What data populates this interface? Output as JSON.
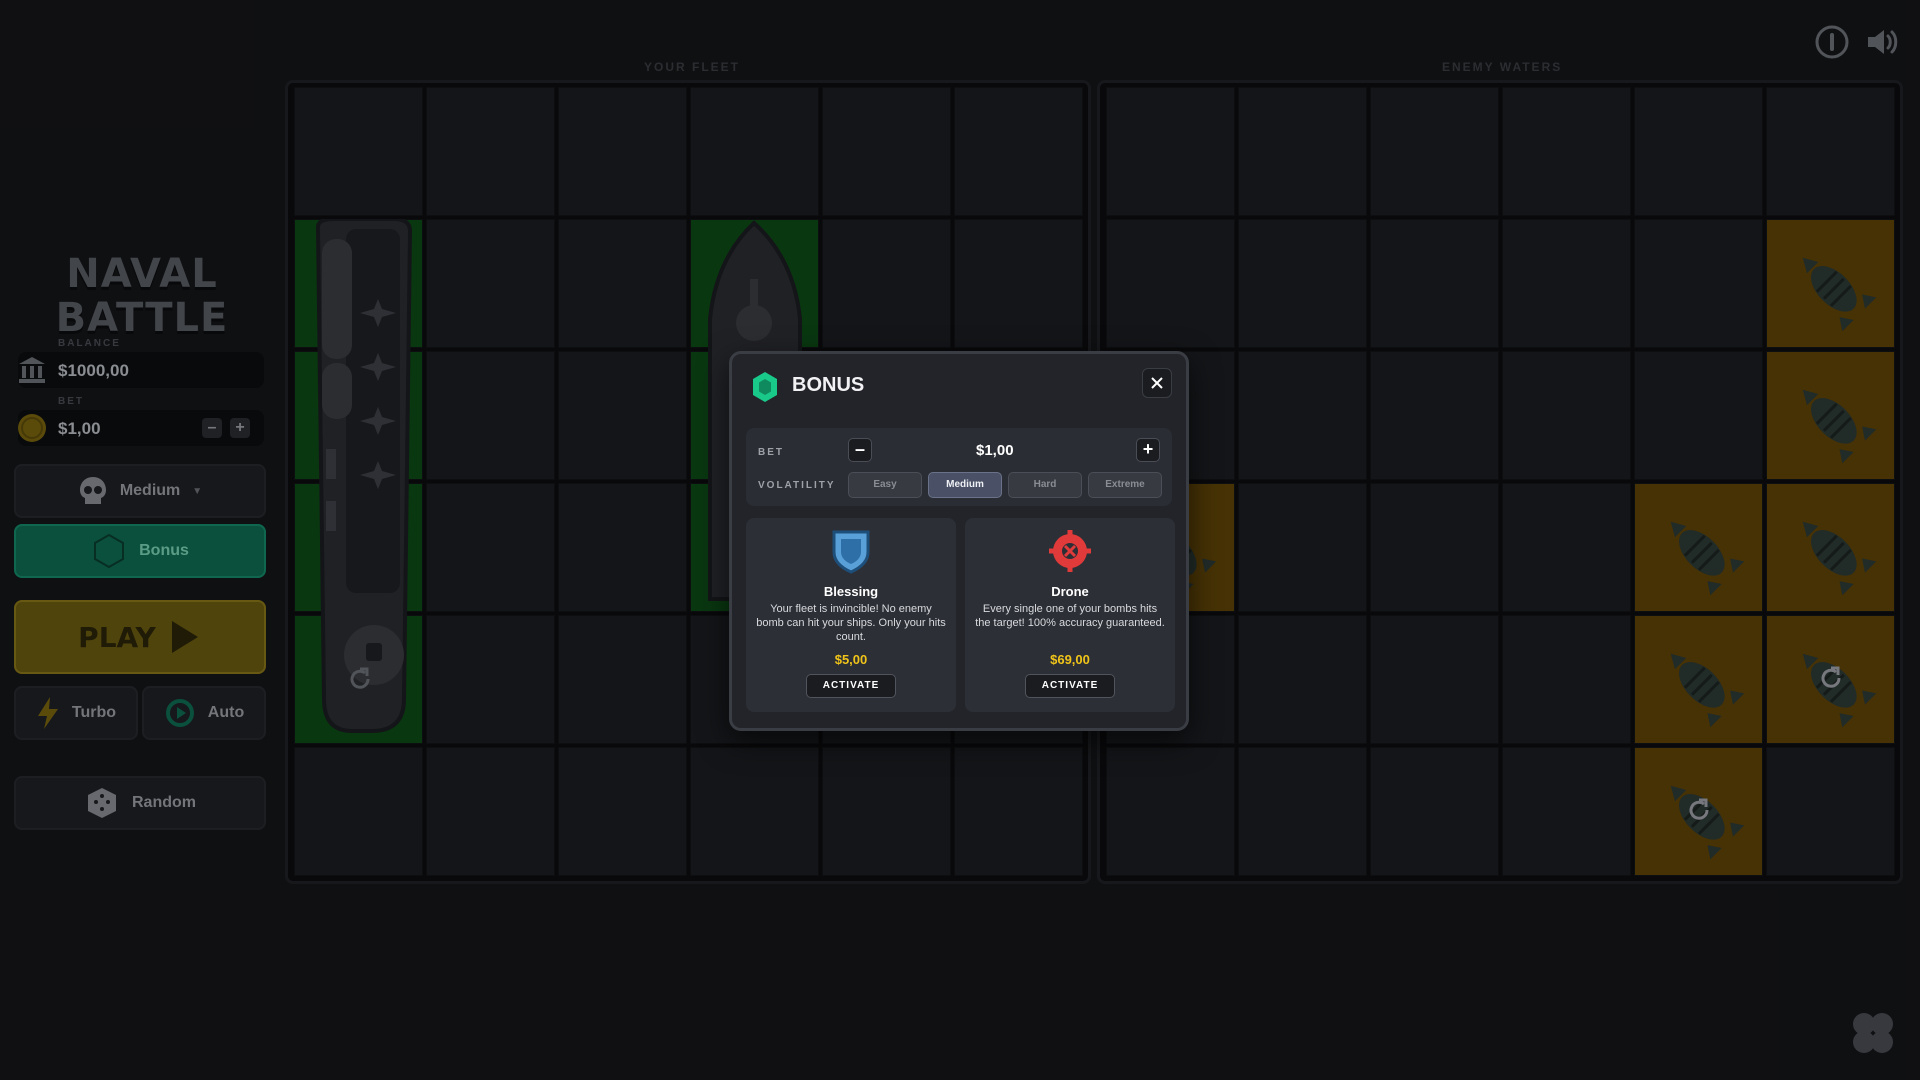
{
  "header": {
    "info_icon": "info-icon",
    "sound_icon": "speaker-icon"
  },
  "sidebar": {
    "logo_line1": "NAVAL",
    "logo_line2": "BATTLE",
    "balance_label": "BALANCE",
    "balance_value": "$1000,00",
    "bet_label": "BET",
    "bet_value": "$1,00",
    "bet_minus": "–",
    "bet_plus": "+",
    "difficulty_label": "Medium",
    "bonus_label": "Bonus",
    "play_label": "PLAY",
    "turbo_label": "Turbo",
    "auto_label": "Auto",
    "random_label": "Random"
  },
  "boards": {
    "fleet_title": "YOUR FLEET",
    "enemy_title": "ENEMY WATERS"
  },
  "modal": {
    "title": "BONUS",
    "bet_label": "BET",
    "bet_value": "$1,00",
    "minus": "–",
    "plus": "+",
    "volatility_label": "VOLATILITY",
    "volatility_options": [
      "Easy",
      "Medium",
      "Hard",
      "Extreme"
    ],
    "volatility_selected": "Medium",
    "cards": [
      {
        "name": "Blessing",
        "description": "Your fleet is invincible! No enemy bomb can hit your ships. Only your hits count.",
        "price": "$5,00",
        "button": "ACTIVATE",
        "icon": "shield-icon"
      },
      {
        "name": "Drone",
        "description": "Every single one of your bombs hits the target! 100% accuracy guaranteed.",
        "price": "$69,00",
        "button": "ACTIVATE",
        "icon": "crosshair-icon"
      }
    ]
  },
  "colors": {
    "accent_green": "#0f6b52",
    "play_yellow": "#6b5b12",
    "price_gold": "#f0c419",
    "ship_cell": "#0c4a16",
    "bomb_cell": "#5e4307"
  }
}
